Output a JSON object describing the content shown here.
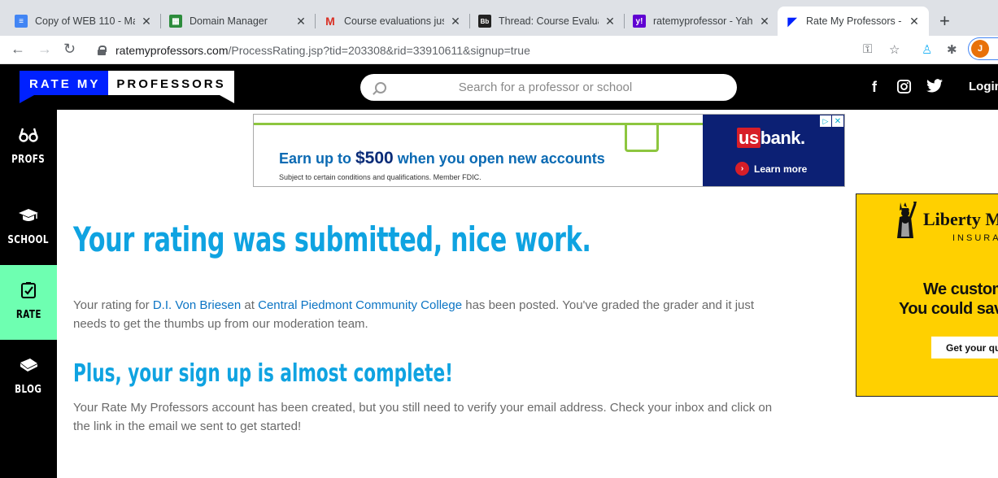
{
  "browser": {
    "tabs": [
      {
        "title": "Copy of WEB 110 - Mas",
        "icon": "docs-icon"
      },
      {
        "title": "Domain Manager",
        "icon": "domain-icon"
      },
      {
        "title": "Course evaluations just",
        "icon": "gmail-icon"
      },
      {
        "title": "Thread: Course Evaluati",
        "icon": "blackboard-icon"
      },
      {
        "title": "ratemyprofessor - Yaho",
        "icon": "yahoo-icon"
      },
      {
        "title": "Rate My Professors - Re",
        "icon": "rmp-icon"
      }
    ],
    "new_tab": "+",
    "url_host": "ratemyprofessors.com",
    "url_path": "/ProcessRating.jsp?tid=203308&rid=33910611&signup=true",
    "profile_initial": "J"
  },
  "header": {
    "logo_part1": "RATE MY",
    "logo_part2": "PROFESSORS",
    "search_placeholder": "Search for a professor or school",
    "login": "Login"
  },
  "sidebar": {
    "items": [
      {
        "label": "PROFS",
        "icon": "glasses-icon"
      },
      {
        "label": "SCHOOL",
        "icon": "graduation-cap-icon"
      },
      {
        "label": "RATE",
        "icon": "checkbox-icon",
        "active": true
      },
      {
        "label": "BLOG",
        "icon": "book-icon"
      }
    ]
  },
  "ad_top": {
    "headline_pre": "Earn up to ",
    "headline_amount": "$500",
    "headline_post": " when you open new accounts",
    "fine_print": "Subject to certain conditions and qualifications. Member FDIC.",
    "brand_us": "us",
    "brand_rest": "bank.",
    "cta": "Learn more"
  },
  "ad_side": {
    "brand": "Liberty M",
    "brand_sub": "INSURA",
    "line1": "We custom",
    "line2": "You could sav",
    "cta": "Get your quo"
  },
  "main": {
    "heading": "Your rating was submitted, nice work.",
    "p1_pre": "Your rating for ",
    "professor": "D.I. Von Briesen",
    "p1_mid": " at ",
    "school": "Central Piedmont Community College",
    "p1_post": " has been posted. You've graded the grader and it just needs to get the thumbs up from our moderation team.",
    "heading2": "Plus, your sign up is almost complete!",
    "p2": "Your Rate My Professors account has been created, but you still need to verify your email address. Check your inbox and click on the link in the email we sent to get started!"
  },
  "colors": {
    "accent_blue": "#0fa3e1",
    "link_blue": "#0b74c4",
    "rate_active": "#6effb1",
    "logo_blue": "#0021ff"
  }
}
